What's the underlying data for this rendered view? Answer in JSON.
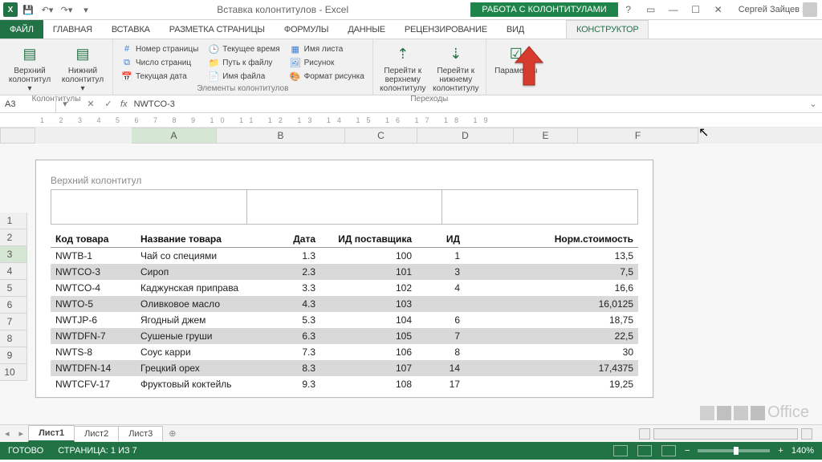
{
  "titlebar": {
    "title": "Вставка колонтитулов - Excel",
    "context": "РАБОТА С КОЛОНТИТУЛАМИ",
    "user": "Сергей Зайцев"
  },
  "tabs": {
    "file": "ФАЙЛ",
    "home": "ГЛАВНАЯ",
    "insert": "ВСТАВКА",
    "layout": "РАЗМЕТКА СТРАНИЦЫ",
    "formulas": "ФОРМУЛЫ",
    "data": "ДАННЫЕ",
    "review": "РЕЦЕНЗИРОВАНИЕ",
    "view": "ВИД",
    "design": "КОНСТРУКТОР"
  },
  "ribbon": {
    "group1_label": "Колонтитулы",
    "top_header": "Верхний\nколонтитул ▾",
    "bottom_header": "Нижний\nколонтитул ▾",
    "group2_label": "Элементы колонтитулов",
    "elems": {
      "page_no": "Номер страницы",
      "cur_time": "Текущее время",
      "sheet": "Имя листа",
      "page_count": "Число страниц",
      "path": "Путь к файлу",
      "picture": "Рисунок",
      "cur_date": "Текущая дата",
      "filename": "Имя файла",
      "fmt_pic": "Формат рисунка"
    },
    "group3_label": "Переходы",
    "goto_top": "Перейти к верхнему\nколонтитулу",
    "goto_bottom": "Перейти к нижнему\nколонтитулу",
    "params": "Параметры"
  },
  "namebox": "A3",
  "formula": "NWTCO-3",
  "header_area_label": "Верхний колонтитул",
  "columns": [
    "A",
    "B",
    "C",
    "D",
    "E",
    "F"
  ],
  "headers": [
    "Код товара",
    "Название товара",
    "Дата",
    "ИД поставщика",
    "ИД",
    "Норм.стоимость"
  ],
  "rows": [
    {
      "n": 2,
      "a": "NWTB-1",
      "b": "Чай со специями",
      "c": "1.3",
      "d": "100",
      "e": "1",
      "f": "13,5"
    },
    {
      "n": 3,
      "a": "NWTCO-3",
      "b": "Сироп",
      "c": "2.3",
      "d": "101",
      "e": "3",
      "f": "7,5"
    },
    {
      "n": 4,
      "a": "NWTCO-4",
      "b": "Каджунская приправа",
      "c": "3.3",
      "d": "102",
      "e": "4",
      "f": "16,6"
    },
    {
      "n": 5,
      "a": "NWTO-5",
      "b": "Оливковое масло",
      "c": "4.3",
      "d": "103",
      "e": "",
      "f": "16,0125"
    },
    {
      "n": 6,
      "a": "NWTJP-6",
      "b": "Ягодный джем",
      "c": "5.3",
      "d": "104",
      "e": "6",
      "f": "18,75"
    },
    {
      "n": 7,
      "a": "NWTDFN-7",
      "b": "Сушеные груши",
      "c": "6.3",
      "d": "105",
      "e": "7",
      "f": "22,5"
    },
    {
      "n": 8,
      "a": "NWTS-8",
      "b": "Соус карри",
      "c": "7.3",
      "d": "106",
      "e": "8",
      "f": "30"
    },
    {
      "n": 9,
      "a": "NWTDFN-14",
      "b": "Грецкий орех",
      "c": "8.3",
      "d": "107",
      "e": "14",
      "f": "17,4375"
    },
    {
      "n": 10,
      "a": "NWTCFV-17",
      "b": "Фруктовый коктейль",
      "c": "9.3",
      "d": "108",
      "e": "17",
      "f": "19,25"
    }
  ],
  "sheets": {
    "s1": "Лист1",
    "s2": "Лист2",
    "s3": "Лист3"
  },
  "status": {
    "ready": "ГОТОВО",
    "page": "СТРАНИЦА: 1 ИЗ 7",
    "zoom": "140%"
  },
  "watermark": "Office",
  "ruler": "1 2 3 4 5 6 7 8 9 10 11 12 13 14 15 16 17 18 19"
}
